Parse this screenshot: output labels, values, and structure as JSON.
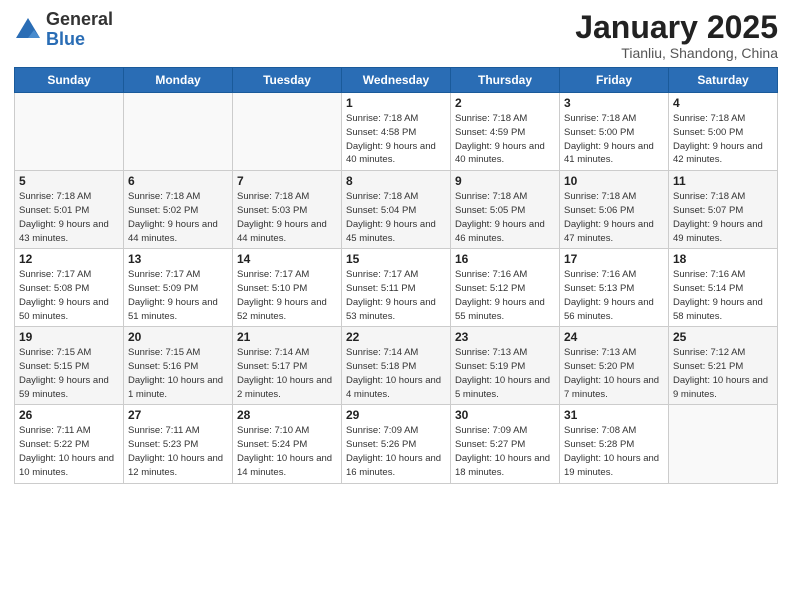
{
  "logo": {
    "general": "General",
    "blue": "Blue"
  },
  "title": "January 2025",
  "subtitle": "Tianliu, Shandong, China",
  "weekdays": [
    "Sunday",
    "Monday",
    "Tuesday",
    "Wednesday",
    "Thursday",
    "Friday",
    "Saturday"
  ],
  "weeks": [
    [
      {
        "day": "",
        "info": ""
      },
      {
        "day": "",
        "info": ""
      },
      {
        "day": "",
        "info": ""
      },
      {
        "day": "1",
        "info": "Sunrise: 7:18 AM\nSunset: 4:58 PM\nDaylight: 9 hours and 40 minutes."
      },
      {
        "day": "2",
        "info": "Sunrise: 7:18 AM\nSunset: 4:59 PM\nDaylight: 9 hours and 40 minutes."
      },
      {
        "day": "3",
        "info": "Sunrise: 7:18 AM\nSunset: 5:00 PM\nDaylight: 9 hours and 41 minutes."
      },
      {
        "day": "4",
        "info": "Sunrise: 7:18 AM\nSunset: 5:00 PM\nDaylight: 9 hours and 42 minutes."
      }
    ],
    [
      {
        "day": "5",
        "info": "Sunrise: 7:18 AM\nSunset: 5:01 PM\nDaylight: 9 hours and 43 minutes."
      },
      {
        "day": "6",
        "info": "Sunrise: 7:18 AM\nSunset: 5:02 PM\nDaylight: 9 hours and 44 minutes."
      },
      {
        "day": "7",
        "info": "Sunrise: 7:18 AM\nSunset: 5:03 PM\nDaylight: 9 hours and 44 minutes."
      },
      {
        "day": "8",
        "info": "Sunrise: 7:18 AM\nSunset: 5:04 PM\nDaylight: 9 hours and 45 minutes."
      },
      {
        "day": "9",
        "info": "Sunrise: 7:18 AM\nSunset: 5:05 PM\nDaylight: 9 hours and 46 minutes."
      },
      {
        "day": "10",
        "info": "Sunrise: 7:18 AM\nSunset: 5:06 PM\nDaylight: 9 hours and 47 minutes."
      },
      {
        "day": "11",
        "info": "Sunrise: 7:18 AM\nSunset: 5:07 PM\nDaylight: 9 hours and 49 minutes."
      }
    ],
    [
      {
        "day": "12",
        "info": "Sunrise: 7:17 AM\nSunset: 5:08 PM\nDaylight: 9 hours and 50 minutes."
      },
      {
        "day": "13",
        "info": "Sunrise: 7:17 AM\nSunset: 5:09 PM\nDaylight: 9 hours and 51 minutes."
      },
      {
        "day": "14",
        "info": "Sunrise: 7:17 AM\nSunset: 5:10 PM\nDaylight: 9 hours and 52 minutes."
      },
      {
        "day": "15",
        "info": "Sunrise: 7:17 AM\nSunset: 5:11 PM\nDaylight: 9 hours and 53 minutes."
      },
      {
        "day": "16",
        "info": "Sunrise: 7:16 AM\nSunset: 5:12 PM\nDaylight: 9 hours and 55 minutes."
      },
      {
        "day": "17",
        "info": "Sunrise: 7:16 AM\nSunset: 5:13 PM\nDaylight: 9 hours and 56 minutes."
      },
      {
        "day": "18",
        "info": "Sunrise: 7:16 AM\nSunset: 5:14 PM\nDaylight: 9 hours and 58 minutes."
      }
    ],
    [
      {
        "day": "19",
        "info": "Sunrise: 7:15 AM\nSunset: 5:15 PM\nDaylight: 9 hours and 59 minutes."
      },
      {
        "day": "20",
        "info": "Sunrise: 7:15 AM\nSunset: 5:16 PM\nDaylight: 10 hours and 1 minute."
      },
      {
        "day": "21",
        "info": "Sunrise: 7:14 AM\nSunset: 5:17 PM\nDaylight: 10 hours and 2 minutes."
      },
      {
        "day": "22",
        "info": "Sunrise: 7:14 AM\nSunset: 5:18 PM\nDaylight: 10 hours and 4 minutes."
      },
      {
        "day": "23",
        "info": "Sunrise: 7:13 AM\nSunset: 5:19 PM\nDaylight: 10 hours and 5 minutes."
      },
      {
        "day": "24",
        "info": "Sunrise: 7:13 AM\nSunset: 5:20 PM\nDaylight: 10 hours and 7 minutes."
      },
      {
        "day": "25",
        "info": "Sunrise: 7:12 AM\nSunset: 5:21 PM\nDaylight: 10 hours and 9 minutes."
      }
    ],
    [
      {
        "day": "26",
        "info": "Sunrise: 7:11 AM\nSunset: 5:22 PM\nDaylight: 10 hours and 10 minutes."
      },
      {
        "day": "27",
        "info": "Sunrise: 7:11 AM\nSunset: 5:23 PM\nDaylight: 10 hours and 12 minutes."
      },
      {
        "day": "28",
        "info": "Sunrise: 7:10 AM\nSunset: 5:24 PM\nDaylight: 10 hours and 14 minutes."
      },
      {
        "day": "29",
        "info": "Sunrise: 7:09 AM\nSunset: 5:26 PM\nDaylight: 10 hours and 16 minutes."
      },
      {
        "day": "30",
        "info": "Sunrise: 7:09 AM\nSunset: 5:27 PM\nDaylight: 10 hours and 18 minutes."
      },
      {
        "day": "31",
        "info": "Sunrise: 7:08 AM\nSunset: 5:28 PM\nDaylight: 10 hours and 19 minutes."
      },
      {
        "day": "",
        "info": ""
      }
    ]
  ]
}
